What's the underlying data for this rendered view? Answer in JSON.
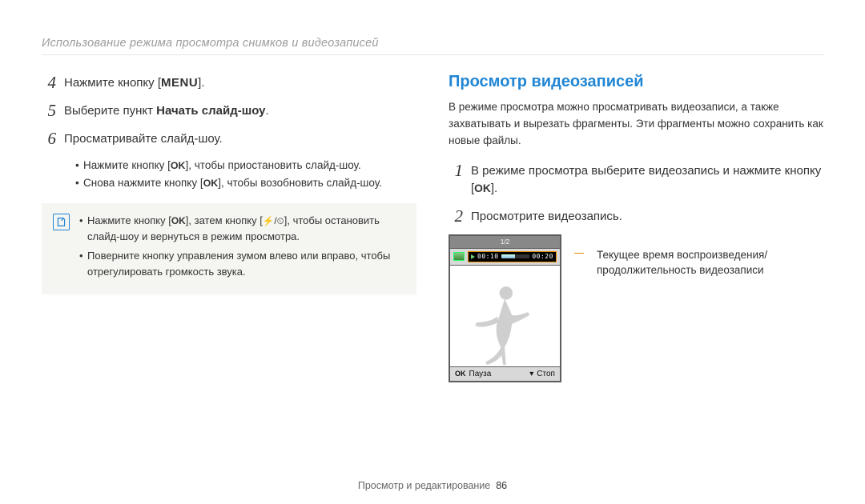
{
  "breadcrumb": "Использование режима просмотра снимков и видеозаписей",
  "left": {
    "step4_num": "4",
    "step4_pre": "Нажмите кнопку [",
    "step4_btn": "MENU",
    "step4_post": "].",
    "step5_num": "5",
    "step5_pre": "Выберите пункт ",
    "step5_bold": "Начать слайд-шоу",
    "step5_post": ".",
    "step6_num": "6",
    "step6_text": "Просматривайте слайд-шоу.",
    "bullet1_pre": "Нажмите кнопку [",
    "bullet1_post": "], чтобы приостановить слайд-шоу.",
    "bullet2_pre": "Снова нажмите кнопку [",
    "bullet2_post": "], чтобы возобновить слайд-шоу.",
    "note1_a": "Нажмите кнопку [",
    "note1_b": "], затем кнопку [",
    "note1_c": "], чтобы остановить слайд-шоу и вернуться в режим просмотра.",
    "note2": "Поверните кнопку управления зумом влево или вправо, чтобы отрегулировать громкость звука."
  },
  "right": {
    "title": "Просмотр видеозаписей",
    "intro": "В режиме просмотра можно просматривать видеозаписи, а также захватывать и вырезать фрагменты. Эти фрагменты можно сохранить как новые файлы.",
    "step1_num": "1",
    "step1_pre": "В режиме просмотра выберите видеозапись и нажмите кнопку [",
    "step1_post": "].",
    "step2_num": "2",
    "step2_text": "Просмотрите видеозапись.",
    "caption": "Текущее время воспроизведения/продолжительность видеозаписи",
    "player": {
      "count": "1/2",
      "time_cur": "00:10",
      "time_tot": "00:20",
      "pause_label": "Пауза",
      "stop_label": "Стоп"
    }
  },
  "footer_section": "Просмотр и редактирование",
  "footer_page": "86",
  "glyph": {
    "ok": "OK",
    "flash_timer": "⚡/⏲"
  }
}
